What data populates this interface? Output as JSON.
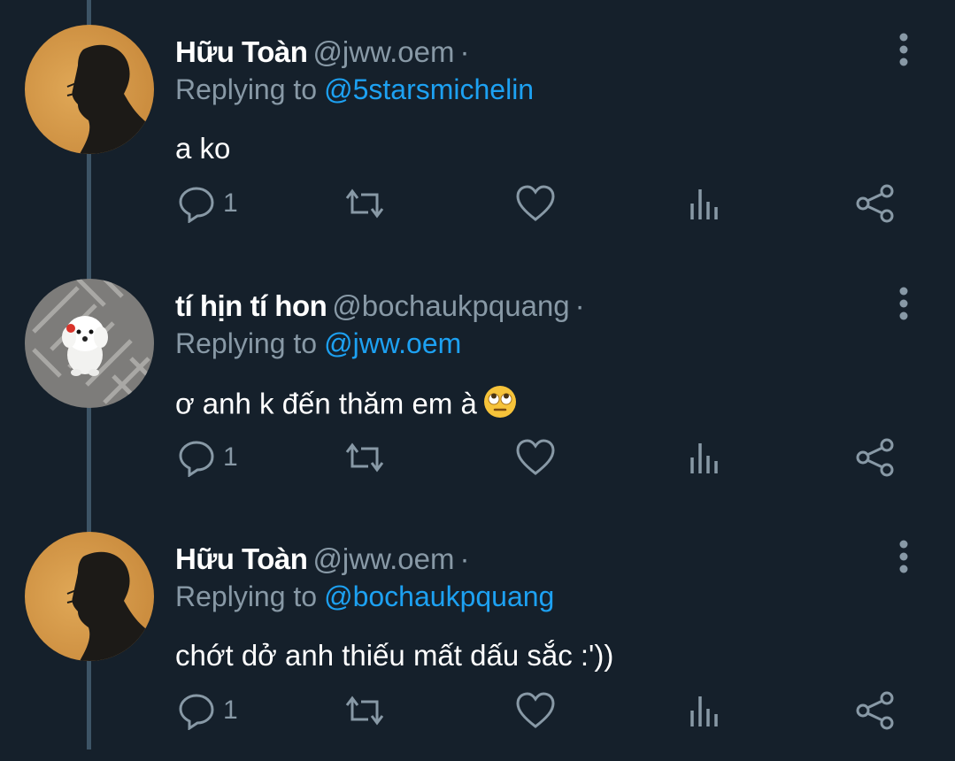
{
  "tweets": [
    {
      "name": "Hữu Toàn",
      "handle": "@jww.oem",
      "separator": "·",
      "replying_label": "Replying to",
      "replying_to": "@5starsmichelin",
      "text": "a ko",
      "reply_count": "1",
      "avatar": "profile-silhouette"
    },
    {
      "name": "tí hịn tí hon",
      "handle": "@bochaukpquang",
      "separator": "·",
      "replying_label": "Replying to",
      "replying_to": "@jww.oem",
      "text": "ơ anh k đến thăm em à",
      "emoji": "face-with-rolling-eyes",
      "reply_count": "1",
      "avatar": "white-puppy"
    },
    {
      "name": "Hữu Toàn",
      "handle": "@jww.oem",
      "separator": "·",
      "replying_label": "Replying to",
      "replying_to": "@bochaukpquang",
      "text": "chớt dở anh thiếu mất dấu sắc :'))",
      "reply_count": "1",
      "avatar": "profile-silhouette"
    }
  ],
  "colors": {
    "background": "#15202b",
    "primary_text": "#ffffff",
    "secondary_text": "#8899a6",
    "accent": "#1da1f2",
    "thread_line": "#3d5466"
  },
  "icons": [
    "reply-icon",
    "retweet-icon",
    "like-icon",
    "analytics-icon",
    "share-icon",
    "more-icon"
  ]
}
